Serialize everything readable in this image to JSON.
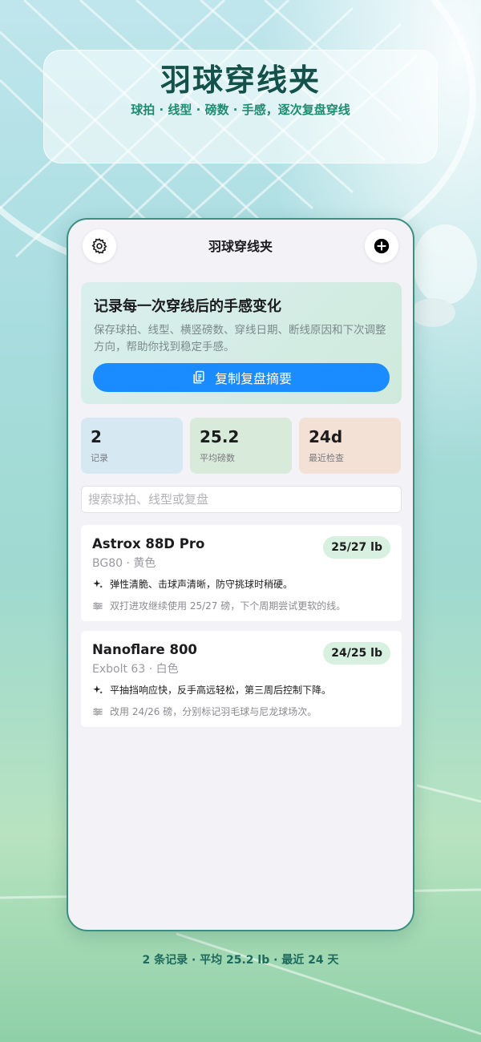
{
  "hero": {
    "title": "羽球穿线夹",
    "subtitle": "球拍 · 线型 · 磅数 · 手感，逐次复盘穿线"
  },
  "nav": {
    "title": "羽球穿线夹",
    "left_icon": "gear-icon",
    "right_icon": "plus-circle-icon"
  },
  "intro": {
    "title": "记录每一次穿线后的手感变化",
    "description": "保存球拍、线型、横竖磅数、穿线日期、断线原因和下次调整方向，帮助你找到稳定手感。",
    "copy_button": "复制复盘摘要",
    "copy_icon": "copy-icon"
  },
  "stats": [
    {
      "value": "2",
      "label": "记录"
    },
    {
      "value": "25.2",
      "label": "平均磅数"
    },
    {
      "value": "24d",
      "label": "最近检查"
    }
  ],
  "search": {
    "placeholder": "搜索球拍、线型或复盘",
    "value": ""
  },
  "records": [
    {
      "racket": "Astrox 88D Pro",
      "string": "BG80 · 黄色",
      "tension": "25/27 lb",
      "feel": "弹性清脆、击球声清晰，防守挑球时稍硬。",
      "plan": "双打进攻继续使用 25/27 磅，下个周期尝试更软的线。"
    },
    {
      "racket": "Nanoflare 800",
      "string": "Exbolt 63 · 白色",
      "tension": "24/25 lb",
      "feel": "平抽挡响应快，反手高远轻松，第三周后控制下降。",
      "plan": "改用 24/26 磅，分别标记羽毛球与尼龙球场次。"
    }
  ],
  "footer": {
    "summary": "2 条记录 · 平均 25.2 lb · 最近 24 天"
  },
  "colors": {
    "accent": "#1a8cff",
    "brand": "#14514a",
    "tension_badge": "#d8f0e0"
  }
}
